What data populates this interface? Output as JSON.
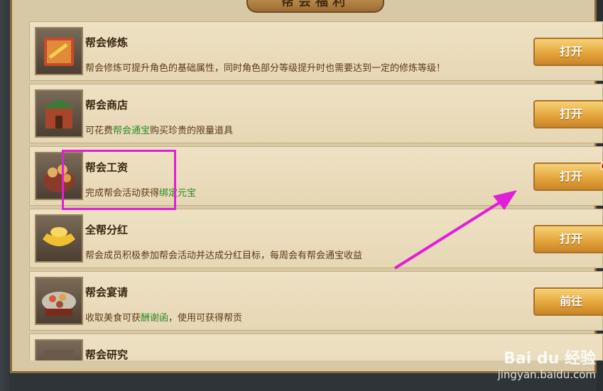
{
  "window": {
    "title": "帮会福利"
  },
  "items": [
    {
      "title": "帮会修炼",
      "desc_parts": [
        [
          "帮会修炼可提升角色的基础属性，同时角色部分等级提升时也需要达到一定的修炼等级！",
          false
        ]
      ],
      "button": "打开",
      "icon": "scroll-book-icon",
      "badge": false
    },
    {
      "title": "帮会商店",
      "desc_parts": [
        [
          "可花费",
          false
        ],
        [
          "帮会通宝",
          true
        ],
        [
          "购买珍贵的限量道具",
          false
        ]
      ],
      "button": "打开",
      "icon": "shop-building-icon",
      "badge": false
    },
    {
      "title": "帮会工资",
      "desc_parts": [
        [
          "完成帮会活动获得",
          false
        ],
        [
          "绑定元宝",
          true
        ]
      ],
      "button": "打开",
      "icon": "coin-bag-icon",
      "badge": true
    },
    {
      "title": "全帮分红",
      "desc_parts": [
        [
          "帮会成员积极参加帮会活动并达成分红目标，每周会有帮会通宝收益",
          false
        ]
      ],
      "button": "打开",
      "icon": "gold-ingot-icon",
      "badge": false
    },
    {
      "title": "帮会宴请",
      "desc_parts": [
        [
          "收取美食可获",
          false
        ],
        [
          "酬谢函",
          true
        ],
        [
          "，使用可获得帮贡",
          false
        ]
      ],
      "button": "前往",
      "icon": "feast-table-icon",
      "badge": false
    },
    {
      "title": "帮会研究",
      "desc_parts": [],
      "button": "",
      "icon": "research-icon",
      "badge": false
    }
  ],
  "watermark": {
    "brand": "Bai du 经验",
    "url": "jingyan.baidu.com"
  },
  "colors": {
    "highlight": "#e020d8",
    "button": "#e2a238",
    "accent_text": "#2e8a26"
  }
}
